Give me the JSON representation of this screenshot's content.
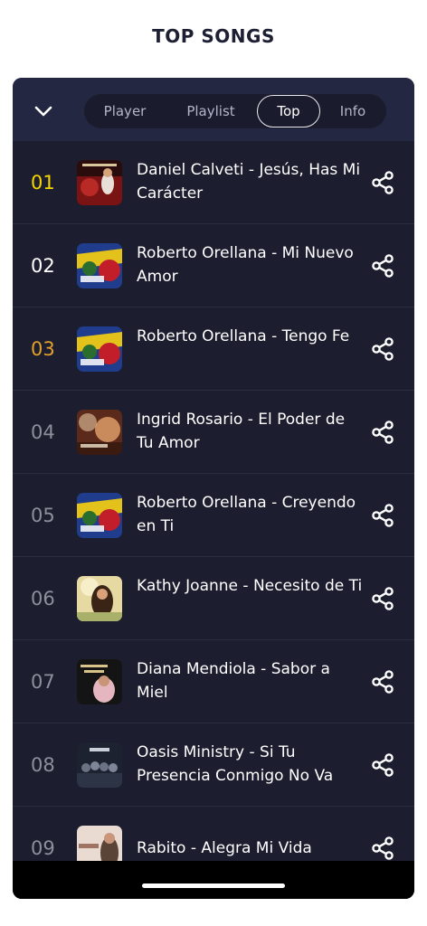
{
  "page": {
    "title": "TOP SONGS"
  },
  "tabs": [
    {
      "label": "Player",
      "active": false
    },
    {
      "label": "Playlist",
      "active": false
    },
    {
      "label": "Top",
      "active": true
    },
    {
      "label": "Info",
      "active": false
    }
  ],
  "songs": [
    {
      "rank": "01",
      "title": "Daniel Calveti - Jesús, Has Mi Carácter",
      "rank_color": "#f4d600"
    },
    {
      "rank": "02",
      "title": "Roberto Orellana - Mi Nuevo Amor",
      "rank_color": "#ffffff"
    },
    {
      "rank": "03",
      "title": "Roberto Orellana - Tengo Fe",
      "rank_color": "#e3a02a"
    },
    {
      "rank": "04",
      "title": "Ingrid Rosario - El Poder de Tu Amor",
      "rank_color": "#8d8f9c"
    },
    {
      "rank": "05",
      "title": "Roberto Orellana - Creyendo en Ti",
      "rank_color": "#8d8f9c"
    },
    {
      "rank": "06",
      "title": "Kathy Joanne - Necesito de Ti",
      "rank_color": "#8d8f9c"
    },
    {
      "rank": "07",
      "title": "Diana Mendiola - Sabor a Miel",
      "rank_color": "#8d8f9c"
    },
    {
      "rank": "08",
      "title": "Oasis Ministry - Si Tu Presencia Conmigo No Va",
      "rank_color": "#8d8f9c"
    },
    {
      "rank": "09",
      "title": "Rabito - Alegra Mi Vida",
      "rank_color": "#8d8f9c"
    }
  ],
  "colors": {
    "panel": "#1c1d2e",
    "header": "#232742",
    "accent_gold": "#f4d600"
  },
  "icons": {
    "collapse": "chevron-down-icon",
    "share": "share-icon"
  }
}
